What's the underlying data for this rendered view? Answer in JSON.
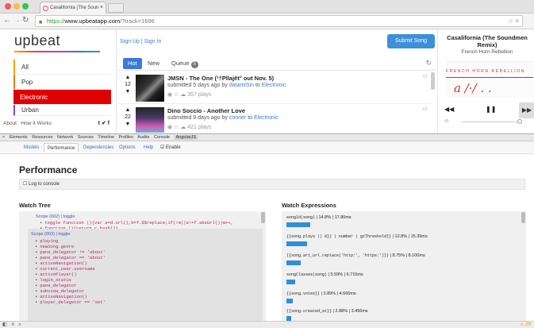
{
  "browser": {
    "tab_title": "Casalifornia (The Soun",
    "tab_close": "×",
    "url_https": "https://",
    "url_host": "www.upbeatapp.com",
    "url_path": "/?track=1696"
  },
  "sidebar": {
    "logo": "upbeat",
    "items": [
      {
        "label": "All",
        "color": "#f0a500"
      },
      {
        "label": "Pop",
        "color": "#e87c1d"
      },
      {
        "label": "Electronic",
        "color": "#e10000"
      },
      {
        "label": "Urban",
        "color": "#8e44ad"
      }
    ],
    "footer_about": "About",
    "footer_how": "How It Works",
    "footer_social": "t  ✔  f"
  },
  "header": {
    "signup": "Sign Up",
    "separator": "|",
    "signin": "Sign In",
    "submit": "Submit Song"
  },
  "tabs": {
    "hot": "Hot",
    "new": "New",
    "queue": "Queue",
    "queue_count": "5"
  },
  "songs": [
    {
      "votes": "12",
      "title": "JMSN - The One (¹†Pllajêt° out Nov. 5)",
      "submitted": "submitted 5 days ago by",
      "user": "datamiSin",
      "to": "to",
      "genre": "Electronic",
      "plays": "357 plays",
      "rank": "#2"
    },
    {
      "votes": "22",
      "title": "Dino Soccio - Another Love",
      "submitted": "submitted 9 days ago by",
      "user": "conner",
      "to": "to",
      "genre": "Electronic",
      "plays": "421 plays",
      "rank": "#3"
    }
  ],
  "player": {
    "title": "Casalifornia (The Soundmen Remix)",
    "artist": "French Horn Rebellion",
    "art_text": "FRENCH HORN REBELLION",
    "art_script": "a    /·/  .  .",
    "volume_label": "40"
  },
  "devtools": {
    "toolbar": [
      "×",
      "Elements",
      "Resources",
      "Network",
      "Sources",
      "Timeline",
      "Profiles",
      "Audits",
      "Console",
      "AngularJS"
    ],
    "subtabs": [
      "Models",
      "Performance",
      "Dependencies",
      "Options",
      "Help"
    ],
    "enable_label": "Enable",
    "perf_heading": "Performance",
    "log_label": "Log to console",
    "watch_tree_heading": "Watch Tree",
    "watch_expr_heading": "Watch Expressions",
    "scope1": "Scope (002) | toggle",
    "tree_top": [
      "toggle function (){var a=d.url(),b=f.$$replace;if(!m||a!=f.absUrl())m++,",
      "function (){return c.hash()}"
    ],
    "scope2": "Scope (003) | toggle",
    "tree_inner": [
      "playing",
      "newSong.genre",
      "pane_delegator != 'about'",
      "pane_delegator == 'about'",
      "activeNavigation()",
      "current_user.username",
      "activePlayer()",
      "login_status",
      "pane_delegator",
      "subview_delegator",
      "activeNavigation()",
      "player_delegator == 'set'"
    ],
    "watch_rows": [
      {
        "expr": "songId(song)",
        "stat": " | 14.8% | 17.80ms",
        "pct": 14.8
      },
      {
        "expr": "{{song.plays || 0}} | number | gtThreshold}}",
        "stat": " | 12.8% | 15.39ms",
        "pct": 12.8
      },
      {
        "expr": "{{song.art_url.replace('http:', 'https:')}}",
        "stat": " | 8.75% | 8.100ms",
        "pct": 8.75
      },
      {
        "expr": "songClasses(song)",
        "stat": " | 5.59% | 6.715ms",
        "pct": 5.59
      },
      {
        "expr": "{{song.votes}}",
        "stat": " | 3.89% | 4.666ms",
        "pct": 3.89
      },
      {
        "expr": "{{song.created_at}}",
        "stat": " | 2.88% | 3.456ms",
        "pct": 2.88
      }
    ],
    "status_warn": "⚠ 29"
  }
}
